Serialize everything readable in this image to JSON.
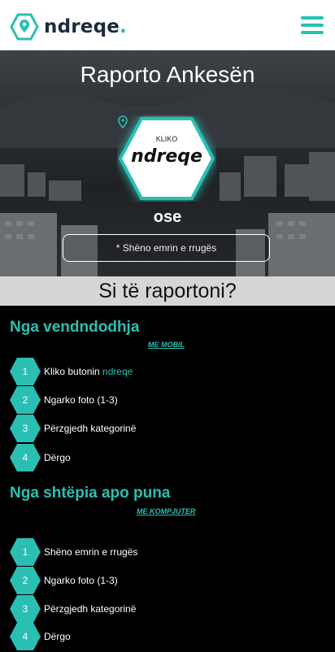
{
  "header": {
    "brand": "ndreqe",
    "brand_dot": ".",
    "logo_icon": "location-pin-hex-icon",
    "menu_icon": "hamburger-menu-icon"
  },
  "hero": {
    "title": "Raporto Ankesën",
    "button_small": "KLIKO",
    "button_word": "ndreqe",
    "button_icon": "location-pin-icon",
    "or_text": "ose",
    "street_placeholder": "* Shëno emrin e rrugës"
  },
  "howto": {
    "title": "Si të raportoni?"
  },
  "location_section": {
    "title": "Nga vendndodhja",
    "sub_link": "ME MOBIL",
    "steps": [
      {
        "num": "1",
        "text_before": "Kliko butonin ",
        "accent": "ndreqe"
      },
      {
        "num": "2",
        "text": "Ngarko foto (1-3)"
      },
      {
        "num": "3",
        "text": "Përzgjedh kategorinë"
      },
      {
        "num": "4",
        "text": "Dërgo"
      }
    ]
  },
  "home_section": {
    "title": "Nga shtëpia apo puna",
    "sub_link": "ME KOMPJUTER",
    "steps": [
      {
        "num": "1",
        "text": "Shëno emrin e rrugës"
      },
      {
        "num": "2",
        "text": "Ngarko foto (1-3)"
      },
      {
        "num": "3",
        "text": "Përzgjedh kategorinë"
      },
      {
        "num": "4",
        "text": "Dërgo"
      }
    ]
  },
  "colors": {
    "accent": "#2bbfb4",
    "dark_navy": "#1a2b3c",
    "bar_gray": "#d6d6d6"
  }
}
